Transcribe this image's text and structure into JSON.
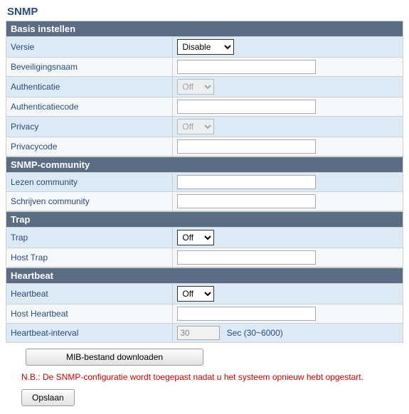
{
  "page_title": "SNMP",
  "sections": {
    "basic": {
      "header": "Basis instellen",
      "version_label": "Versie",
      "version_value": "Disable",
      "secname_label": "Beveiligingsnaam",
      "secname_value": "",
      "auth_label": "Authenticatie",
      "auth_value": "Off",
      "authcode_label": "Authenticatiecode",
      "authcode_value": "",
      "privacy_label": "Privacy",
      "privacy_value": "Off",
      "privacycode_label": "Privacycode",
      "privacycode_value": ""
    },
    "community": {
      "header": "SNMP-community",
      "read_label": "Lezen community",
      "read_value": "",
      "write_label": "Schrijven community",
      "write_value": ""
    },
    "trap": {
      "header": "Trap",
      "trap_label": "Trap",
      "trap_value": "Off",
      "host_label": "Host Trap",
      "host_value": ""
    },
    "heartbeat": {
      "header": "Heartbeat",
      "hb_label": "Heartbeat",
      "hb_value": "Off",
      "host_label": "Host Heartbeat",
      "host_value": "",
      "interval_label": "Heartbeat-interval",
      "interval_value": "30",
      "interval_suffix": "Sec (30~6000)"
    }
  },
  "buttons": {
    "download_mib": "MIB-bestand downloaden",
    "save": "Opslaan"
  },
  "note": "N.B.: De SNMP-configuratie wordt toegepast nadat u het systeem opnieuw hebt opgestart."
}
